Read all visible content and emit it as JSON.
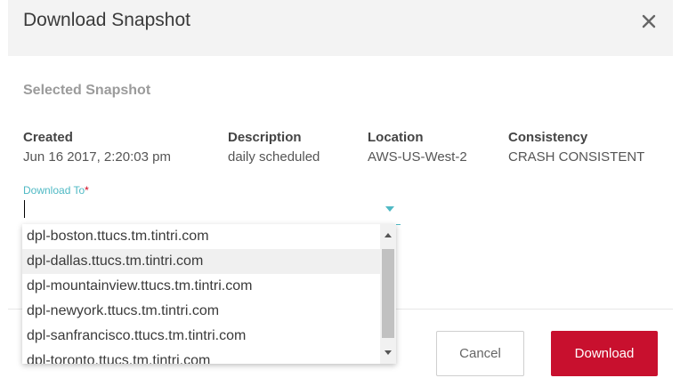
{
  "dialog": {
    "title": "Download Snapshot"
  },
  "selected_snapshot": {
    "heading": "Selected Snapshot",
    "columns": [
      {
        "label": "Created",
        "value": "Jun 16 2017, 2:20:03 pm"
      },
      {
        "label": "Description",
        "value": "daily scheduled"
      },
      {
        "label": "Location",
        "value": "AWS-US-West-2"
      },
      {
        "label": "Consistency",
        "value": "CRASH CONSISTENT"
      }
    ]
  },
  "download_to": {
    "label": "Download To",
    "required_marker": "*",
    "value": "",
    "options": [
      "dpl-boston.ttucs.tm.tintri.com",
      "dpl-dallas.ttucs.tm.tintri.com",
      "dpl-mountainview.ttucs.tm.tintri.com",
      "dpl-newyork.ttucs.tm.tintri.com",
      "dpl-sanfrancisco.ttucs.tm.tintri.com",
      "dpl-toronto.ttucs.tm.tintri.com"
    ]
  },
  "buttons": {
    "cancel": "Cancel",
    "download": "Download"
  },
  "colors": {
    "accent": "#4fb9c4",
    "primary_button": "#c8102e",
    "required": "#d0021b"
  },
  "icons": {
    "close": "close-icon",
    "dropdown": "chevron-down-icon"
  }
}
